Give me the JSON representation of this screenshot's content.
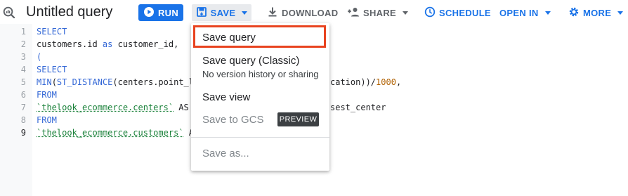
{
  "header": {
    "query_icon": "query-search-icon",
    "title": "Untitled query"
  },
  "toolbar": {
    "run": {
      "label": "RUN",
      "icon": "play-circle-icon"
    },
    "save": {
      "label": "SAVE",
      "icon": "save-disk-icon"
    },
    "download": {
      "label": "DOWNLOAD",
      "icon": "download-icon"
    },
    "share": {
      "label": "SHARE",
      "icon": "person-add-icon"
    },
    "schedule": {
      "label": "SCHEDULE",
      "icon": "clock-icon"
    },
    "open_in": {
      "label": "OPEN IN"
    },
    "more": {
      "label": "MORE",
      "icon": "gear-icon"
    }
  },
  "editor": {
    "line_numbers": [
      "1",
      "2",
      "3",
      "4",
      "5",
      "6",
      "7",
      "8",
      "9"
    ],
    "active_line": "9",
    "lines": [
      {
        "parts": [
          {
            "text": "SELECT",
            "type": "kw"
          }
        ]
      },
      {
        "parts": [
          {
            "text": "customers.id ",
            "type": "plain"
          },
          {
            "text": "as",
            "type": "kw"
          },
          {
            "text": " customer_id,",
            "type": "plain"
          }
        ]
      },
      {
        "parts": [
          {
            "text": "(",
            "type": "kw"
          }
        ]
      },
      {
        "parts": [
          {
            "text": "SELECT",
            "type": "kw"
          }
        ]
      },
      {
        "parts": [
          {
            "text": "MIN",
            "type": "kw"
          },
          {
            "text": "(",
            "type": "plain"
          },
          {
            "text": "ST_DISTANCE",
            "type": "kw"
          },
          {
            "text": "(centers.point_l",
            "type": "plain"
          }
        ]
      },
      {
        "parts": [
          {
            "text": "FROM",
            "type": "kw"
          }
        ]
      },
      {
        "parts": [
          {
            "text": "`thelook_ecommerce.centers`",
            "type": "str"
          },
          {
            "text": " AS",
            "type": "plain"
          }
        ]
      },
      {
        "parts": [
          {
            "text": "FROM",
            "type": "kw"
          }
        ]
      },
      {
        "parts": [
          {
            "text": "`thelook_ecommerce.customers`",
            "type": "str"
          },
          {
            "text": " A",
            "type": "plain"
          }
        ]
      }
    ],
    "line5_tail": [
      {
        "text": "cation))/",
        "type": "plain"
      },
      {
        "text": "1000",
        "type": "num"
      },
      {
        "text": ",",
        "type": "plain"
      }
    ],
    "line7_tail": [
      {
        "text": "sest_center",
        "type": "plain"
      }
    ]
  },
  "save_menu": {
    "items": [
      {
        "label": "Save query",
        "highlighted": true
      },
      {
        "label": "Save query (Classic)",
        "sublabel": "No version history or sharing"
      },
      {
        "label": "Save view"
      },
      {
        "label": "Save to GCS",
        "disabled": true,
        "badge": "PREVIEW"
      },
      {
        "label": "Save as...",
        "disabled": true
      }
    ]
  },
  "colors": {
    "accent_blue": "#1a73e8",
    "highlight_red": "#e8431f",
    "keyword_blue": "#3367d6",
    "string_green": "#188038",
    "number_orange": "#b06000"
  }
}
